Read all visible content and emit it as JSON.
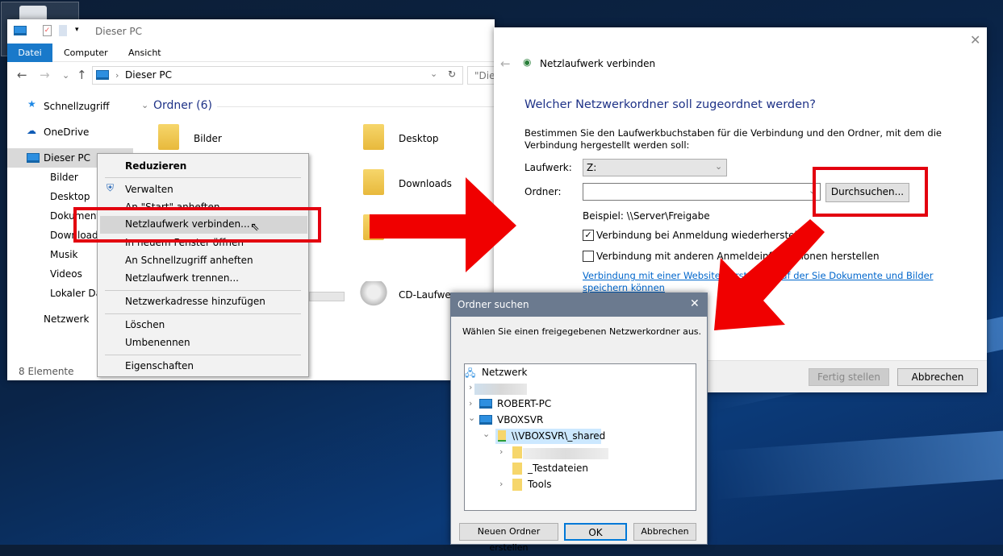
{
  "desktop": {
    "recycle_bin": "recycle-bin"
  },
  "explorer": {
    "title": "Dieser PC",
    "ribbon_tabs": [
      "Datei",
      "Computer",
      "Ansicht"
    ],
    "address": "Dieser PC",
    "search_placeholder": "\"Dies",
    "nav": [
      "Schnellzugriff",
      "OneDrive",
      "Dieser PC",
      "Bilder",
      "Desktop",
      "Dokumente",
      "Downloads",
      "Musik",
      "Videos",
      "Lokaler Dat",
      "Netzwerk"
    ],
    "group_header": "Ordner (6)",
    "folders": [
      "Bilder",
      "Desktop",
      "Downloads"
    ],
    "drive": "CD-Laufwer",
    "status": "8 Elemente"
  },
  "context_menu": {
    "items": [
      "Reduzieren",
      "Verwalten",
      "An \"Start\" anheften",
      "Netzlaufwerk verbinden...",
      "In neuem Fenster öffnen",
      "An Schnellzugriff anheften",
      "Netzlaufwerk trennen...",
      "Netzwerkadresse hinzufügen",
      "Löschen",
      "Umbenennen",
      "Eigenschaften"
    ]
  },
  "map_drive": {
    "title": "Netzlaufwerk verbinden",
    "heading": "Welcher Netzwerkordner soll zugeordnet werden?",
    "description": "Bestimmen Sie den Laufwerkbuchstaben für die Verbindung und den Ordner, mit dem die Verbindung hergestellt werden soll:",
    "drive_label": "Laufwerk:",
    "drive_value": "Z:",
    "folder_label": "Ordner:",
    "folder_value": "",
    "browse": "Durchsuchen...",
    "example": "Beispiel: \\\\Server\\Freigabe",
    "reconnect": "Verbindung bei Anmeldung wiederherstellen",
    "reconnect_checked": true,
    "other_creds": "Verbindung mit anderen Anmeldeinformationen herstellen",
    "other_creds_checked": false,
    "link": "Verbindung mit einer Website herstellen, auf der Sie Dokumente und Bilder speichern können",
    "finish": "Fertig stellen",
    "cancel": "Abbrechen"
  },
  "browse_dialog": {
    "title": "Ordner suchen",
    "prompt": "Wählen Sie einen freigegebenen Netzwerkordner aus.",
    "tree": {
      "root": "Netzwerk",
      "pc1": "ROBERT-PC",
      "pc2": "VBOXSVR",
      "share": "\\\\VBOXSVR\\_shared",
      "sub": [
        "_Testdateien",
        "Tools"
      ]
    },
    "new_folder": "Neuen Ordner erstellen",
    "ok": "OK",
    "cancel": "Abbrechen"
  },
  "colors": {
    "accent": "#1979ca",
    "highlight": "#e3000f",
    "link": "#0066cc",
    "heading": "#1e3287"
  }
}
